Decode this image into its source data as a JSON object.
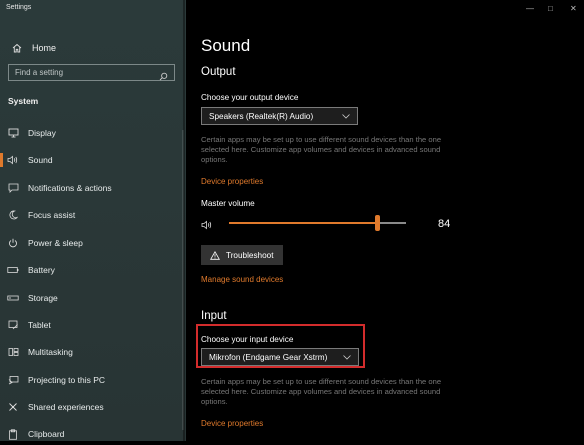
{
  "window": {
    "title": "Settings"
  },
  "sidebar": {
    "home_label": "Home",
    "search_placeholder": "Find a setting",
    "section_label": "System",
    "items": [
      {
        "label": "Display",
        "icon": "monitor-icon"
      },
      {
        "label": "Sound",
        "icon": "speaker-icon",
        "selected": true
      },
      {
        "label": "Notifications & actions",
        "icon": "notification-icon"
      },
      {
        "label": "Focus assist",
        "icon": "moon-icon"
      },
      {
        "label": "Power & sleep",
        "icon": "power-icon"
      },
      {
        "label": "Battery",
        "icon": "battery-icon"
      },
      {
        "label": "Storage",
        "icon": "storage-icon"
      },
      {
        "label": "Tablet",
        "icon": "tablet-icon"
      },
      {
        "label": "Multitasking",
        "icon": "multitasking-icon"
      },
      {
        "label": "Projecting to this PC",
        "icon": "projector-icon"
      },
      {
        "label": "Shared experiences",
        "icon": "shared-icon"
      },
      {
        "label": "Clipboard",
        "icon": "clipboard-icon"
      }
    ]
  },
  "main": {
    "title": "Sound",
    "output": {
      "heading": "Output",
      "device_label": "Choose your output device",
      "device_value": "Speakers (Realtek(R) Audio)",
      "description": "Certain apps may be set up to use different sound devices than the one selected here. Customize app volumes and devices in advanced sound options.",
      "properties_link": "Device properties",
      "volume_label": "Master volume",
      "volume_value": "84",
      "troubleshoot_label": "Troubleshoot",
      "manage_link": "Manage sound devices"
    },
    "input": {
      "heading": "Input",
      "device_label": "Choose your input device",
      "device_value": "Mikrofon (Endgame Gear Xstrm)",
      "description": "Certain apps may be set up to use different sound devices than the one selected here. Customize app volumes and devices in advanced sound options.",
      "properties_link": "Device properties"
    }
  },
  "colors": {
    "accent": "#e07a2c",
    "highlight": "#d32c2c",
    "sidebar_bg": "#2b3a3a"
  }
}
